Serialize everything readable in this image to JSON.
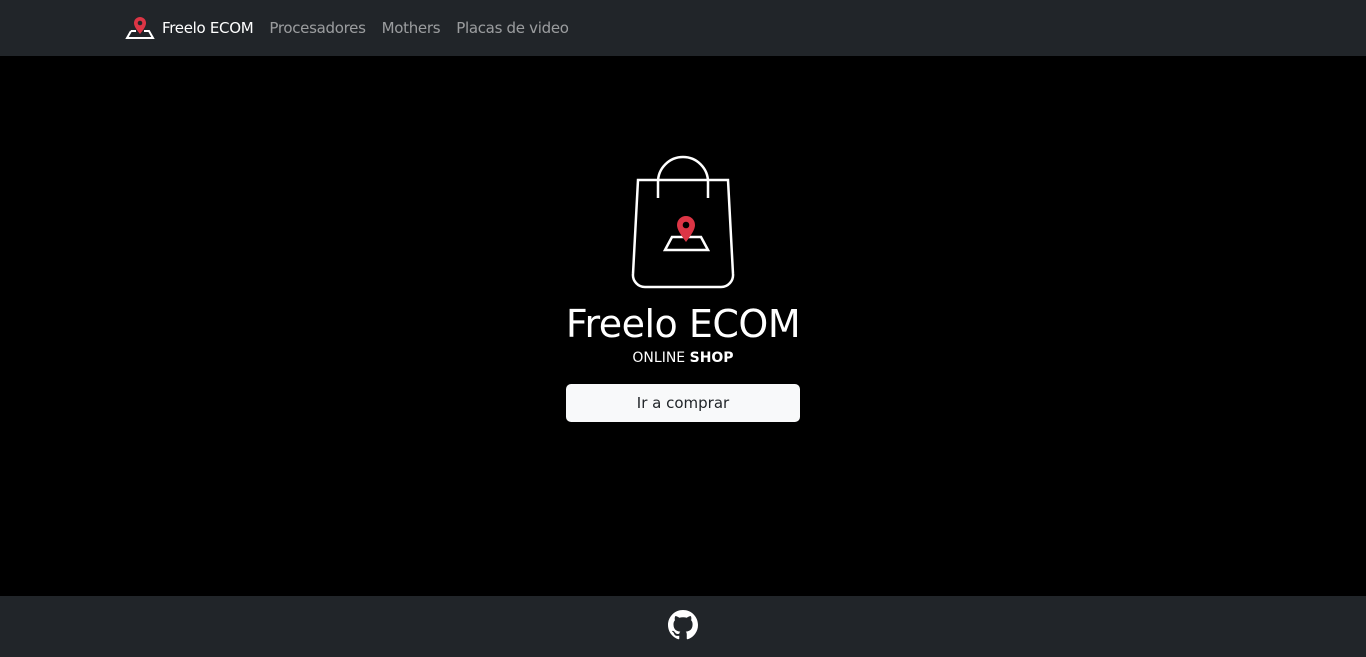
{
  "navbar": {
    "brand": "Freelo ECOM",
    "links": [
      "Procesadores",
      "Mothers",
      "Placas de video"
    ]
  },
  "hero": {
    "title": "Freelo ECOM",
    "subtitle_light": "ONLINE",
    "subtitle_bold": "SHOP",
    "cta": "Ir a comprar"
  },
  "footer": {
    "icon": "github-icon"
  },
  "colors": {
    "accent": "#dc3545",
    "nav_bg": "#212529"
  }
}
